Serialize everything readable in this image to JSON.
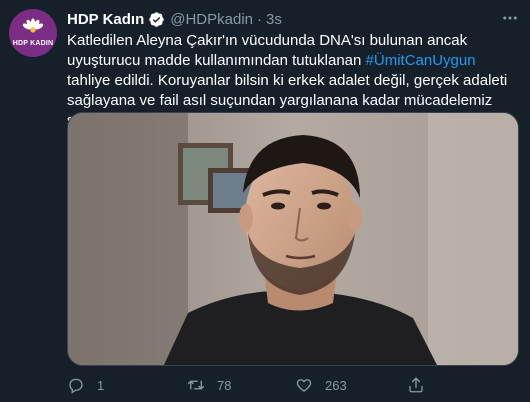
{
  "tweet": {
    "author": {
      "name": "HDP Kadın",
      "handle": "@HDPkadin",
      "avatar_label": "HDP KADIN",
      "verified": true
    },
    "separator": "·",
    "time": "3s",
    "text_part1": "Katledilen Aleyna Çakır'ın vücudunda DNA'sı bulunan ancak uyuşturucu madde kullanımından tutuklanan ",
    "hashtag": "#ÜmitCanUygun",
    "text_part2": " tahliye edildi. Koruyanlar bilsin ki erkek adalet değil, gerçek adaleti sağlayana ve fail asıl suçundan yargılanana kadar mücadelemiz sürecek!",
    "media": {
      "type": "photo",
      "subject": "young man portrait"
    },
    "actions": {
      "reply_count": "1",
      "retweet_count": "78",
      "like_count": "263"
    }
  },
  "colors": {
    "background": "#15202b",
    "text": "#ffffff",
    "secondary": "#8899a6",
    "link": "#1d9bf0",
    "avatar_bg": "#7b2d86"
  }
}
